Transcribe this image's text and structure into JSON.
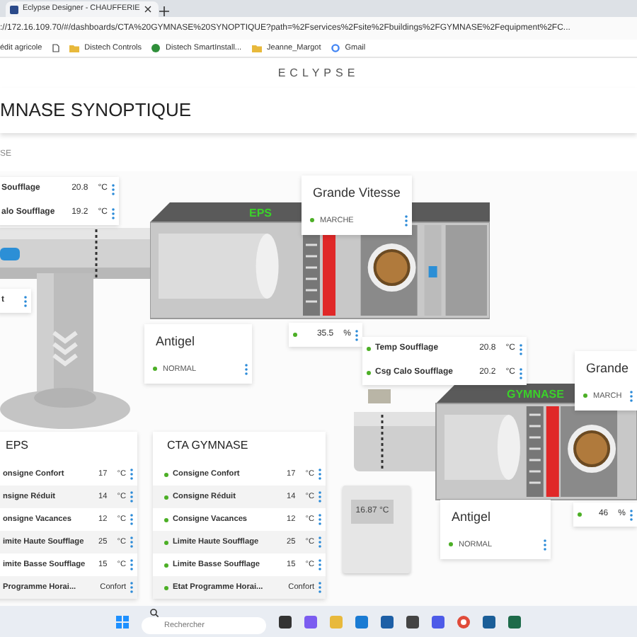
{
  "browser": {
    "tab_title": "Eclypse Designer - CHAUFFERIE",
    "url": "://172.16.109.70/#/dashboards/CTA%20GYMNASE%20SYNOPTIQUE?path=%2Fservices%2Fsite%2Fbuildings%2FGYMNASE%2Fequipment%2FC...",
    "bookmarks": [
      {
        "kind": "plain",
        "label": "édit agricole"
      },
      {
        "kind": "page"
      },
      {
        "kind": "folder",
        "label": "Distech Controls"
      },
      {
        "kind": "site",
        "label": "Distech SmartInstall..."
      },
      {
        "kind": "folder",
        "label": "Jeanne_Margot"
      },
      {
        "kind": "google",
        "label": "Gmail"
      }
    ]
  },
  "header": {
    "logo": "ECLYPSE",
    "title": "MNASE SYNOPTIQUE",
    "breadcrumb": "SE"
  },
  "synoptic": {
    "point_cards": [
      {
        "rows": [
          {
            "label": "Soufflage",
            "value": "20.8",
            "unit": "°C",
            "dot": false
          },
          {
            "label": "alo Soufflage",
            "value": "19.2",
            "unit": "°C",
            "dot": false
          }
        ]
      },
      {
        "rows": [
          {
            "label": "t",
            "dot": false
          }
        ]
      },
      {
        "rows": [
          {
            "value": "35.5",
            "unit": "%",
            "dot": true
          }
        ]
      },
      {
        "rows": [
          {
            "label": "Temp Soufflage",
            "value": "20.8",
            "unit": "°C",
            "dot": true
          },
          {
            "label": "Csg Calo Soufflage",
            "value": "20.2",
            "unit": "°C",
            "dot": true
          }
        ]
      },
      {
        "rows": [
          {
            "value": "46",
            "unit": "%",
            "dot": true
          }
        ]
      }
    ],
    "status_cards": [
      {
        "title": "Grande Vitesse",
        "status": "MARCHE"
      },
      {
        "title": "Antigel",
        "status": "NORMAL"
      },
      {
        "title": "Grande",
        "status": "MARCH"
      },
      {
        "title": "Antigel",
        "status": "NORMAL"
      }
    ],
    "units": [
      {
        "label": "EPS"
      },
      {
        "label": "GYMNASE"
      }
    ],
    "thermostat": {
      "reading": "16.87 °C"
    }
  },
  "lists": [
    {
      "title": "EPS",
      "rows": [
        {
          "label": "onsigne Confort",
          "value": "17",
          "unit": "°C",
          "dot": false
        },
        {
          "label": "nsigne Réduit",
          "value": "14",
          "unit": "°C",
          "dot": false
        },
        {
          "label": "onsigne Vacances",
          "value": "12",
          "unit": "°C",
          "dot": false
        },
        {
          "label": "imite Haute Soufflage",
          "value": "25",
          "unit": "°C",
          "dot": false
        },
        {
          "label": "imite Basse Soufflage",
          "value": "15",
          "unit": "°C",
          "dot": false
        },
        {
          "label": "Programme Horai...",
          "value": "Confort",
          "dot": false
        }
      ]
    },
    {
      "title": "CTA GYMNASE",
      "rows": [
        {
          "label": "Consigne Confort",
          "value": "17",
          "unit": "°C",
          "dot": true
        },
        {
          "label": "Consigne Réduit",
          "value": "14",
          "unit": "°C",
          "dot": true
        },
        {
          "label": "Consigne Vacances",
          "value": "12",
          "unit": "°C",
          "dot": true
        },
        {
          "label": "Limite Haute Soufflage",
          "value": "25",
          "unit": "°C",
          "dot": true
        },
        {
          "label": "Limite Basse Soufflage",
          "value": "15",
          "unit": "°C",
          "dot": true
        },
        {
          "label": "Etat Programme Horai...",
          "value": "Confort",
          "dot": true
        }
      ]
    }
  ],
  "taskbar": {
    "search_placeholder": "Rechercher"
  }
}
